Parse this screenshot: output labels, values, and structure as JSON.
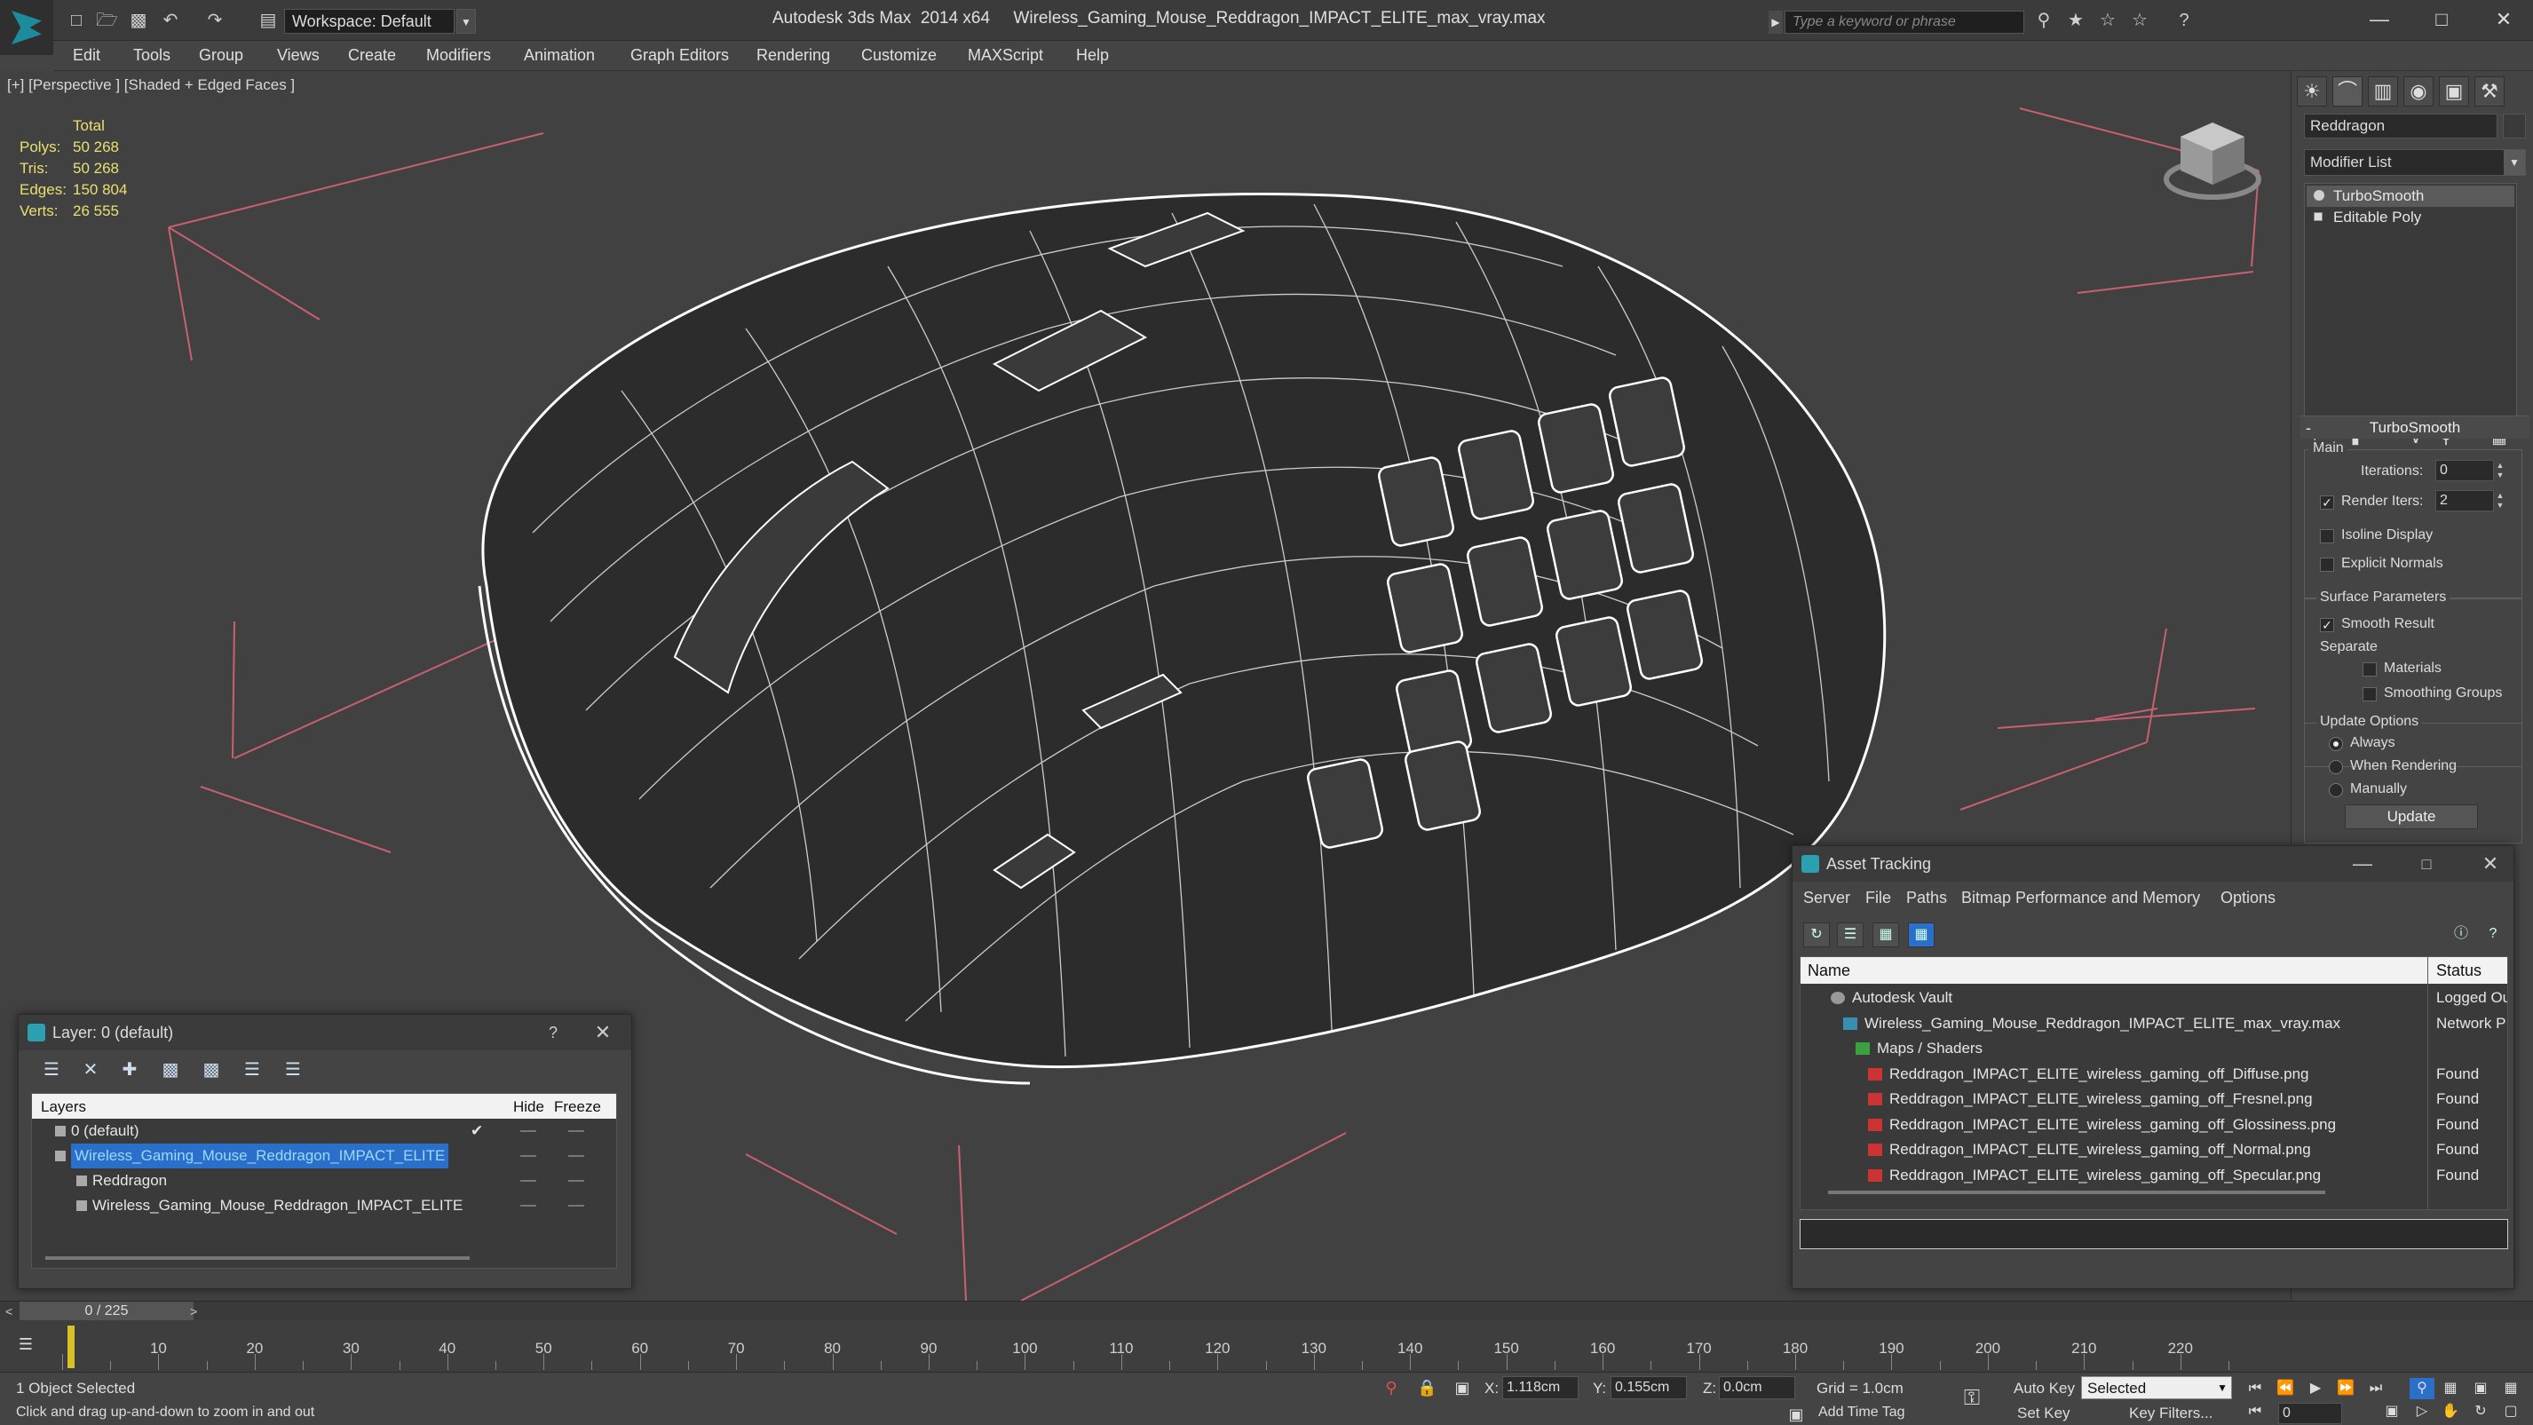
{
  "titlebar": {
    "workspace_label": "Workspace: Default",
    "app_title": "Autodesk 3ds Max  2014 x64     Wireless_Gaming_Mouse_Reddragon_IMPACT_ELITE_max_vray.max",
    "search_placeholder": "Type a keyword or phrase",
    "icons": [
      "new-icon",
      "open-icon",
      "save-icon",
      "undo-icon",
      "redo-icon",
      "project-icon"
    ]
  },
  "menu": [
    "Edit",
    "Tools",
    "Group",
    "Views",
    "Create",
    "Modifiers",
    "Animation",
    "Graph Editors",
    "Rendering",
    "Customize",
    "MAXScript",
    "Help"
  ],
  "viewport": {
    "label": "[+] [Perspective ] [Shaded + Edged Faces ]",
    "stats": {
      "total_label": "Total",
      "rows": [
        {
          "k": "Polys:",
          "v": "50 268"
        },
        {
          "k": "Tris:",
          "v": "50 268"
        },
        {
          "k": "Edges:",
          "v": "150 804"
        },
        {
          "k": "Verts:",
          "v": "26 555"
        }
      ]
    }
  },
  "command_panel": {
    "object_name": "Reddragon",
    "modifier_list": "Modifier List",
    "stack": [
      "TurboSmooth",
      "Editable Poly"
    ],
    "rollout_title": "TurboSmooth",
    "main_label": "Main",
    "iterations_label": "Iterations:",
    "iterations_value": "0",
    "render_iters_label": "Render Iters:",
    "render_iters_value": "2",
    "isoline_label": "Isoline Display",
    "explicit_normals_label": "Explicit Normals",
    "surface_label": "Surface Parameters",
    "smooth_result_label": "Smooth Result",
    "separate_label": "Separate",
    "materials_label": "Materials",
    "smoothing_groups_label": "Smoothing Groups",
    "update_options_label": "Update Options",
    "always_label": "Always",
    "when_rendering_label": "When Rendering",
    "manually_label": "Manually",
    "update_button": "Update"
  },
  "layer_window": {
    "title": "Layer: 0 (default)",
    "help": "?",
    "headers": {
      "layers": "Layers",
      "hide": "Hide",
      "freeze": "Freeze"
    },
    "rows": [
      {
        "name": "0 (default)",
        "indent": 1,
        "selected": false,
        "check": "✔"
      },
      {
        "name": "Wireless_Gaming_Mouse_Reddragon_IMPACT_ELITE",
        "indent": 1,
        "selected": true,
        "check": ""
      },
      {
        "name": "Reddragon",
        "indent": 2,
        "selected": false,
        "check": ""
      },
      {
        "name": "Wireless_Gaming_Mouse_Reddragon_IMPACT_ELITE",
        "indent": 2,
        "selected": false,
        "check": ""
      }
    ]
  },
  "asset_window": {
    "title": "Asset Tracking",
    "menu": [
      "Server",
      "File",
      "Paths",
      "Bitmap Performance and Memory",
      "Options"
    ],
    "headers": {
      "name": "Name",
      "status": "Status"
    },
    "rows": [
      {
        "name": "Autodesk Vault",
        "status": "Logged Ou",
        "indent": 1,
        "icon": "vault"
      },
      {
        "name": "Wireless_Gaming_Mouse_Reddragon_IMPACT_ELITE_max_vray.max",
        "status": "Network P",
        "indent": 2,
        "icon": "maxf"
      },
      {
        "name": "Maps / Shaders",
        "status": "",
        "indent": 3,
        "icon": "fold"
      },
      {
        "name": "Reddragon_IMPACT_ELITE_wireless_gaming_off_Diffuse.png",
        "status": "Found",
        "indent": 4,
        "icon": "png"
      },
      {
        "name": "Reddragon_IMPACT_ELITE_wireless_gaming_off_Fresnel.png",
        "status": "Found",
        "indent": 4,
        "icon": "png"
      },
      {
        "name": "Reddragon_IMPACT_ELITE_wireless_gaming_off_Glossiness.png",
        "status": "Found",
        "indent": 4,
        "icon": "png"
      },
      {
        "name": "Reddragon_IMPACT_ELITE_wireless_gaming_off_Normal.png",
        "status": "Found",
        "indent": 4,
        "icon": "png"
      },
      {
        "name": "Reddragon_IMPACT_ELITE_wireless_gaming_off_Specular.png",
        "status": "Found",
        "indent": 4,
        "icon": "png"
      }
    ]
  },
  "timeline": {
    "frame_display": "0 / 225",
    "ticks": [
      "10",
      "20",
      "30",
      "40",
      "50",
      "60",
      "70",
      "80",
      "90",
      "100",
      "110",
      "120",
      "130",
      "140",
      "150",
      "160",
      "170",
      "180",
      "190",
      "200",
      "210",
      "220"
    ]
  },
  "statusbar": {
    "selected": "1 Object Selected",
    "prompt": "Click and drag up-and-down to zoom in and out",
    "x_label": "X:",
    "x_value": "1.118cm",
    "y_label": "Y:",
    "y_value": "0.155cm",
    "z_label": "Z:",
    "z_value": "0.0cm",
    "grid": "Grid = 1.0cm",
    "auto_key": "Auto Key",
    "selection_set": "Selected",
    "set_key": "Set Key",
    "key_filters": "Key Filters...",
    "add_time_tag": "Add Time Tag",
    "frame_value": "0"
  },
  "colors": {
    "stats_yellow": "#e8e070",
    "selection_blue": "#2a6fc9",
    "grid_red": "#c86070",
    "time_cursor": "#d8c02a"
  }
}
